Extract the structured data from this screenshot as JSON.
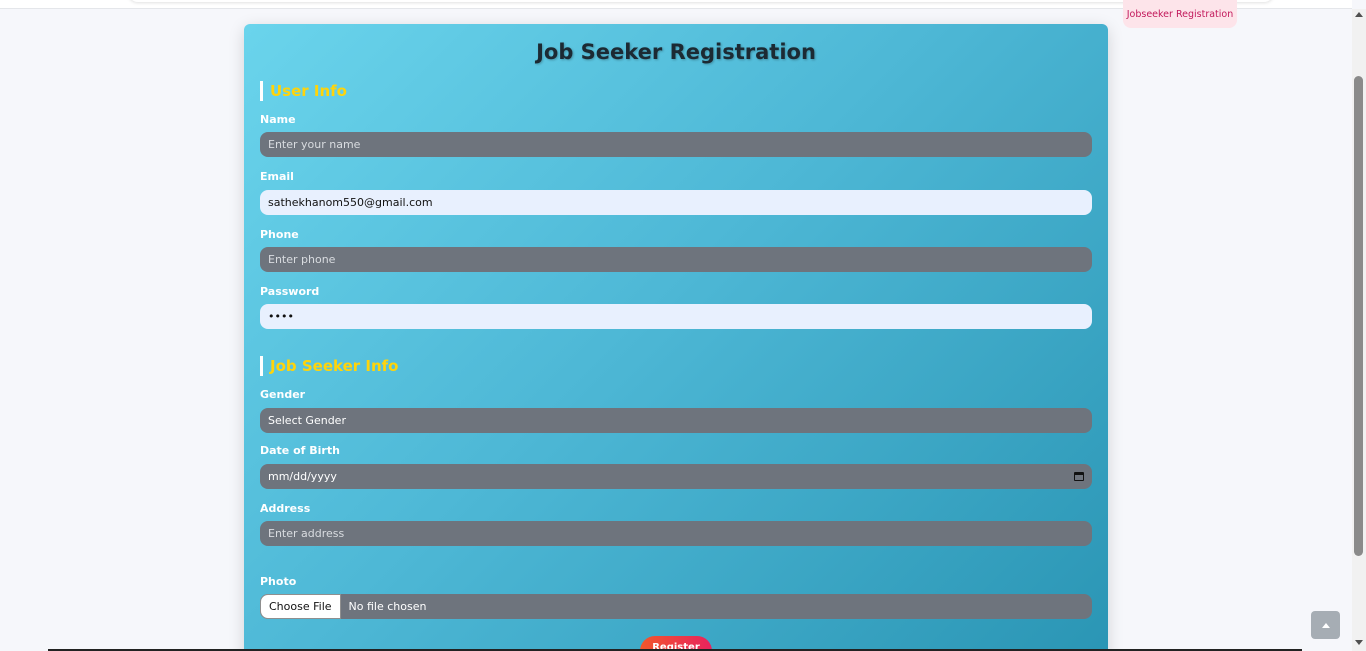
{
  "breadcrumb": {
    "label": "Jobseeker Registration"
  },
  "form": {
    "title": "Job Seeker Registration",
    "user_info": {
      "heading": "User Info",
      "name": {
        "label": "Name",
        "placeholder": "Enter your name",
        "value": ""
      },
      "email": {
        "label": "Email",
        "placeholder": "",
        "value": "sathekhanom550@gmail.com"
      },
      "phone": {
        "label": "Phone",
        "placeholder": "Enter phone",
        "value": ""
      },
      "password": {
        "label": "Password",
        "value": "••••"
      }
    },
    "job_seeker_info": {
      "heading": "Job Seeker Info",
      "gender": {
        "label": "Gender",
        "selected": "Select Gender"
      },
      "dob": {
        "label": "Date of Birth",
        "placeholder": "mm/dd/yyyy"
      },
      "address": {
        "label": "Address",
        "placeholder": "Enter address"
      },
      "photo": {
        "label": "Photo",
        "button": "Choose File",
        "status": "No file chosen"
      }
    },
    "submit_label": "Register"
  },
  "colors": {
    "card_gradient_start": "#6ad4ec",
    "card_gradient_end": "#2a95b4",
    "section_heading": "#ffd40a",
    "register_start": "#f2572b",
    "register_end": "#e8235e"
  }
}
